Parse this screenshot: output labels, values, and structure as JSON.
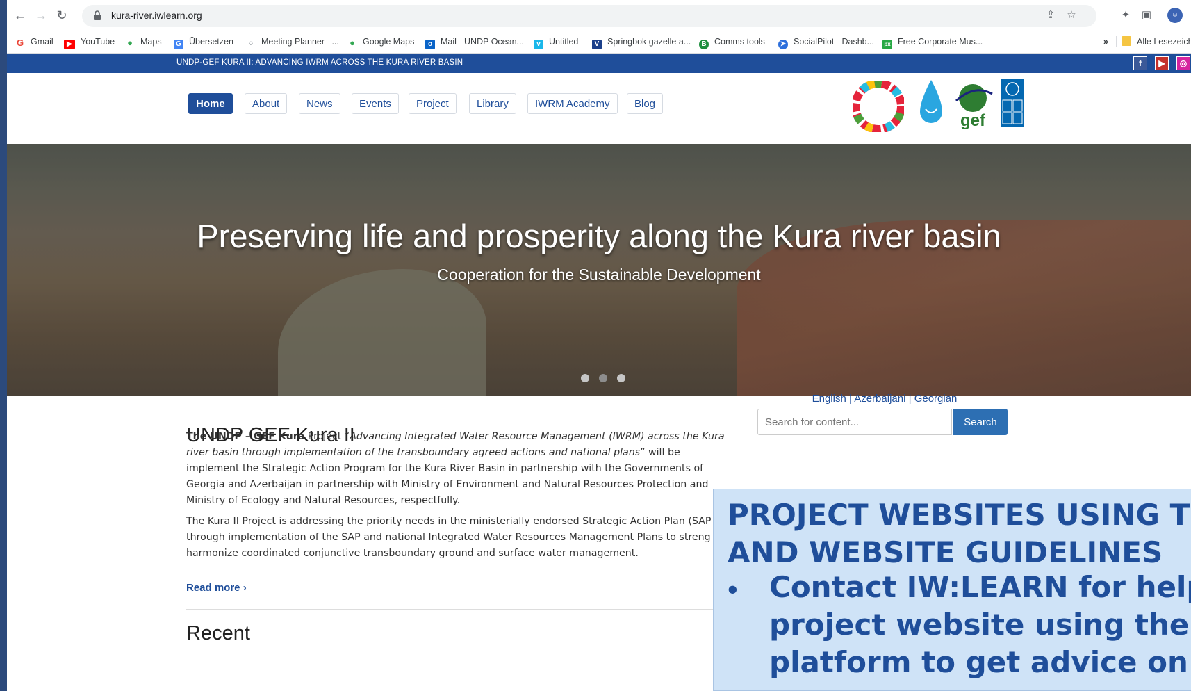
{
  "browser": {
    "url": "kura-river.iwlearn.org",
    "bookmarks": [
      {
        "label": "Gmail",
        "icon": "gmail-icon",
        "color": "#ea4335"
      },
      {
        "label": "YouTube",
        "icon": "youtube-icon",
        "color": "#ff0000"
      },
      {
        "label": "Maps",
        "icon": "maps-icon",
        "color": "#34a853"
      },
      {
        "label": "Übersetzen",
        "icon": "translate-icon",
        "color": "#4285f4"
      },
      {
        "label": "Meeting Planner –...",
        "icon": "meeting-planner-icon",
        "color": "#9aa0a6"
      },
      {
        "label": "Google Maps",
        "icon": "google-maps-icon",
        "color": "#34a853"
      },
      {
        "label": "Mail - UNDP Ocean...",
        "icon": "outlook-icon",
        "color": "#0a64c8"
      },
      {
        "label": "Untitled",
        "icon": "vimeo-icon",
        "color": "#1ab7ea"
      },
      {
        "label": "Springbok gazelle a...",
        "icon": "v-icon",
        "color": "#1b3f8a"
      },
      {
        "label": "Comms tools",
        "icon": "b-icon",
        "color": "#1e8e3e"
      },
      {
        "label": "SocialPilot - Dashb...",
        "icon": "socialpilot-icon",
        "color": "#2d6fdc"
      },
      {
        "label": "Free Corporate Mus...",
        "icon": "px-icon",
        "color": "#27a844"
      }
    ],
    "more_label": "»",
    "all_bookmarks_label": "Alle Lesezeiche"
  },
  "site": {
    "top_banner": "UNDP-GEF KURA II: ADVANCING IWRM ACROSS THE KURA RIVER BASIN",
    "menu": [
      "Home",
      "About",
      "News",
      "Events",
      "Project",
      "Library",
      "IWRM Academy",
      "Blog"
    ],
    "hero": {
      "title": "Preserving life and prosperity along the Kura river basin",
      "subtitle": "Cooperation for the Sustainable Development",
      "active_slide": 2,
      "slide_count": 3
    },
    "main_title": "UNDP GEF Kura II",
    "para1_bold": "The UNDP – GEF Kura",
    "para1_a": " Project “",
    "para1_italic": "Advancing Integrated Water Resource Management (IWRM) across the Kura river basin through implementation of the transboundary agreed actions and national plans",
    "para1_b": "” will be implement the Strategic Action Program for the Kura River Basin in partnership with the Governments of Georgia and Azerbaijan in partnership with Ministry of Environment and Natural Resources Protection and Ministry of Ecology and Natural Resources, respectfully.",
    "para2": "The Kura II Project is addressing the priority needs in the ministerially endorsed Strategic Action Plan (SAP through implementation of the SAP and national Integrated Water Resources Management Plans to streng and harmonize coordinated conjunctive transboundary ground and surface water management.",
    "read_more": "Read more ›",
    "recent_partial": "Recent",
    "languages": {
      "en": "English",
      "sep": "|",
      "az": "Azerbaijani",
      "ka": "Georgian"
    },
    "search_placeholder": "Search for content...",
    "search_button": "Search"
  },
  "overlay": {
    "title": "PROJECT WEBSITES USING THE AND WEBSITE GUIDELINES",
    "bullet": "•",
    "bullet_text": "Contact IW:LEARN for help project website using the IW platform to get advice on t"
  },
  "colors": {
    "brand": "#1f4e9a",
    "overlay_bg": "#cfe3f7"
  }
}
